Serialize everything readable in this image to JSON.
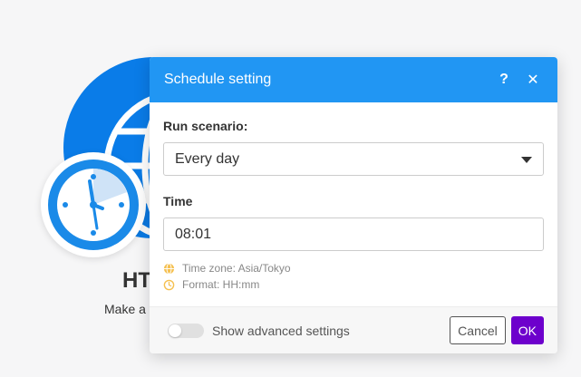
{
  "module": {
    "title": "HT",
    "subtitle": "Make a",
    "icon": "globe-icon",
    "badge_icon": "clock-icon",
    "color": "#0a7ce8"
  },
  "dialog": {
    "title": "Schedule setting",
    "help_label": "?",
    "close_label": "✕",
    "header_color": "#2196f3",
    "run_scenario": {
      "label": "Run scenario:",
      "selected": "Every day"
    },
    "time": {
      "label": "Time",
      "value": "08:01"
    },
    "hints": [
      {
        "icon": "globe-icon",
        "text": "Time zone: Asia/Tokyo"
      },
      {
        "icon": "clock-icon",
        "text": "Format: HH:mm"
      }
    ],
    "footer": {
      "advanced_toggle_label": "Show advanced settings",
      "advanced_enabled": false,
      "cancel_label": "Cancel",
      "ok_label": "OK",
      "ok_color": "#6d00cc"
    }
  }
}
